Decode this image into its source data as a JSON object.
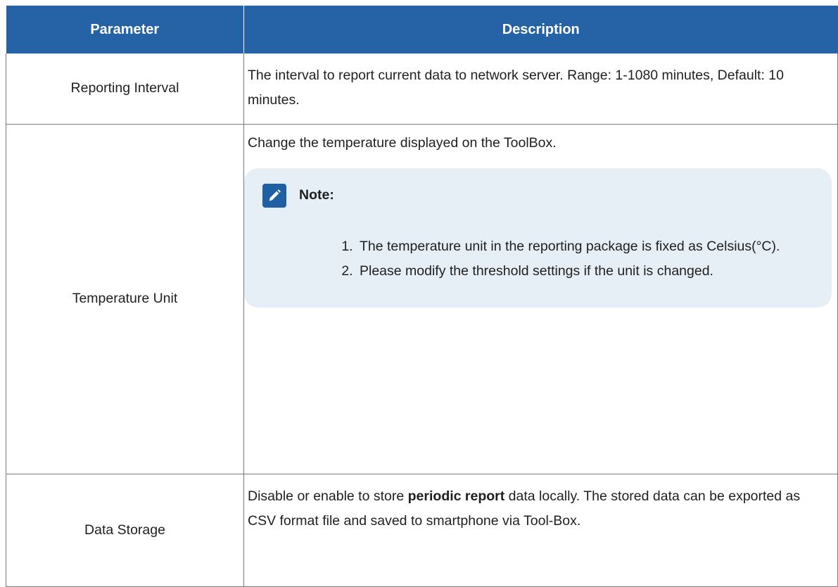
{
  "table": {
    "headers": {
      "parameter": "Parameter",
      "description": "Description"
    },
    "rows": [
      {
        "parameter": "Reporting Interval",
        "description": "The interval to report current data to network server. Range: 1-1080 minutes, Default: 10 minutes."
      },
      {
        "parameter": "Temperature Unit",
        "description": "Change the temperature displayed on the ToolBox.",
        "note": {
          "title": "Note:",
          "icon": "pencil-edit-icon",
          "items": [
            "The temperature unit in the reporting package is fixed as Celsius(°C).",
            "Please modify the threshold settings if the unit is changed."
          ]
        }
      },
      {
        "parameter": "Data Storage",
        "description_pre": "Disable or enable to store ",
        "description_bold": "periodic report",
        "description_post": " data locally. The stored data can be exported as CSV format file and saved to smartphone via Tool-Box."
      }
    ]
  },
  "colors": {
    "header_bg": "#2563a6",
    "note_bg": "#e7eff6",
    "note_icon_bg": "#1f5fa3"
  }
}
